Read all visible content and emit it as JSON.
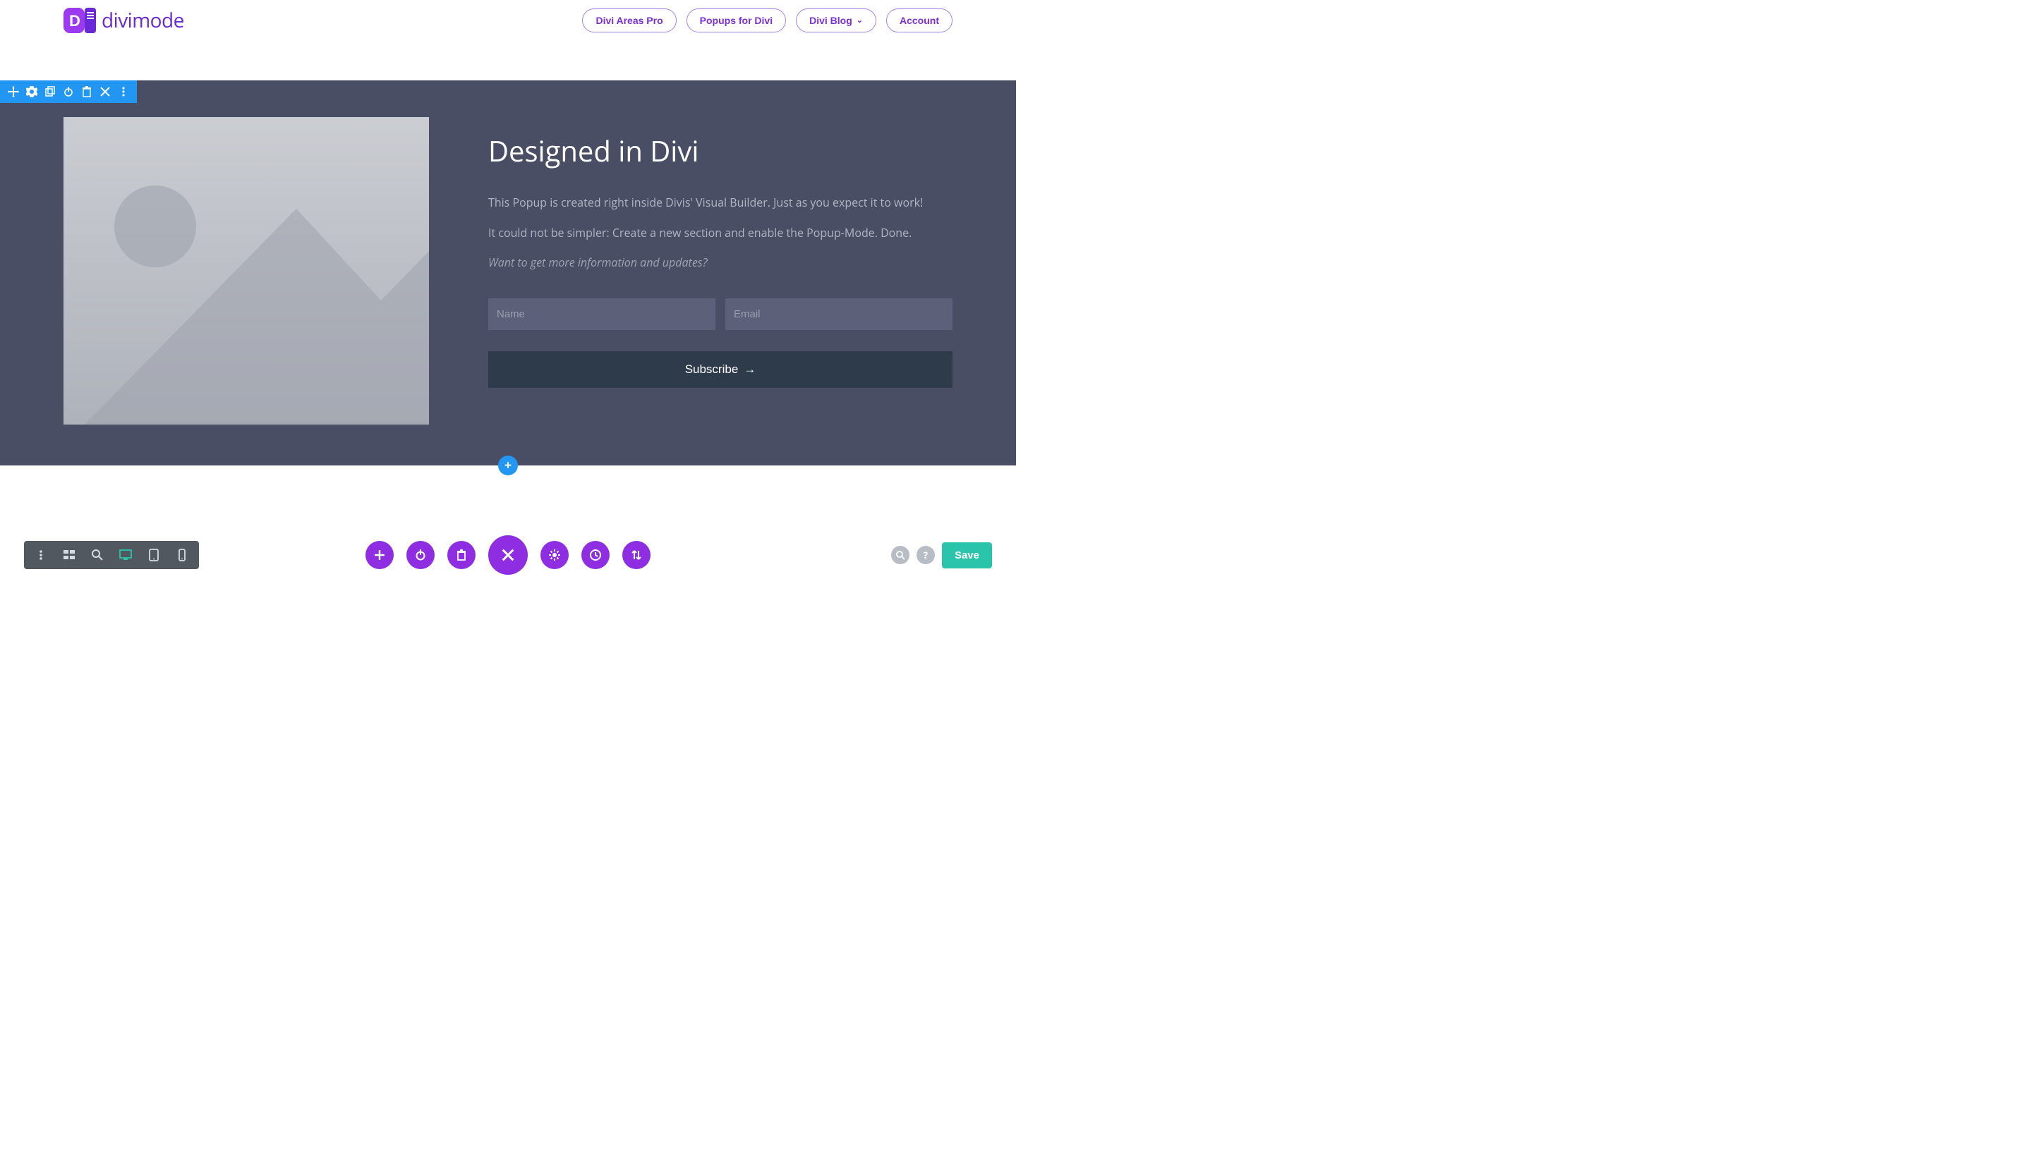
{
  "header": {
    "logo_text": "divimode",
    "nav": [
      {
        "label": "Divi Areas Pro"
      },
      {
        "label": "Popups for Divi"
      },
      {
        "label": "Divi Blog",
        "dropdown": true
      },
      {
        "label": "Account"
      }
    ]
  },
  "section": {
    "heading": "Designed in Divi",
    "para1": "This Popup is created right inside Divis' Visual Builder. Just as you expect it to work!",
    "para2": "It could not be simpler: Create a new section and enable the Popup-Mode. Done.",
    "para_italic": "Want to get more information and updates?",
    "name_placeholder": "Name",
    "email_placeholder": "Email",
    "subscribe_label": "Subscribe",
    "add_label": "+"
  },
  "toolbar_icons": [
    "move",
    "gear",
    "tablet",
    "power",
    "trash",
    "close",
    "dots"
  ],
  "bottom": {
    "save_label": "Save"
  },
  "colors": {
    "purple": "#8e2de2",
    "blue": "#2196f3",
    "teal": "#29c4a9",
    "dark_slate": "#4a4e65"
  }
}
